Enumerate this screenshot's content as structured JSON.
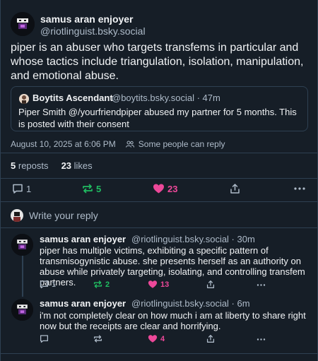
{
  "main_post": {
    "author_name": "samus aran enjoyer",
    "handle": "@riotlinguist.bsky.social",
    "text": "piper is an abuser who targets transfems in particular and whose tactics include triangulation, isolation, manipulation, and emotional abuse.",
    "quote": {
      "author_name": "Boytits Ascendant",
      "meta": "@boytits.bsky.social · 47m",
      "text": "Piper Smith @/yourfriendpiper abused my partner for 5 months. This is posted with their consent"
    },
    "timestamp": "August 10, 2025 at 6:06 PM",
    "reply_restriction": "Some people can reply",
    "reposts_count": "5",
    "reposts_label": "reposts",
    "likes_count": "23",
    "likes_label": "likes",
    "actions": {
      "reply_count": "1",
      "repost_count": "5",
      "like_count": "23"
    }
  },
  "reply_prompt": "Write your reply",
  "replies": [
    {
      "author_name": "samus aran enjoyer",
      "meta": "@riotlinguist.bsky.social · 30m",
      "text": "piper has multiple victims, exhibiting a specific pattern of transmisogynistic abuse. she presents herself as an authority on abuse while privately targeting, isolating, and controlling transfem partners.",
      "reply_count": "1",
      "repost_count": "2",
      "like_count": "13"
    },
    {
      "author_name": "samus aran enjoyer",
      "meta": "@riotlinguist.bsky.social · 6m",
      "text": "i'm not completely clear on how much i am at liberty to share right now but the receipts are clear and horrifying.",
      "reply_count": "",
      "repost_count": "",
      "like_count": "4"
    }
  ],
  "colors": {
    "background": "#161e27",
    "border": "#2e4052",
    "muted_text": "#aebbc9",
    "repost_active": "#20bc61",
    "like_active": "#ec4899"
  }
}
